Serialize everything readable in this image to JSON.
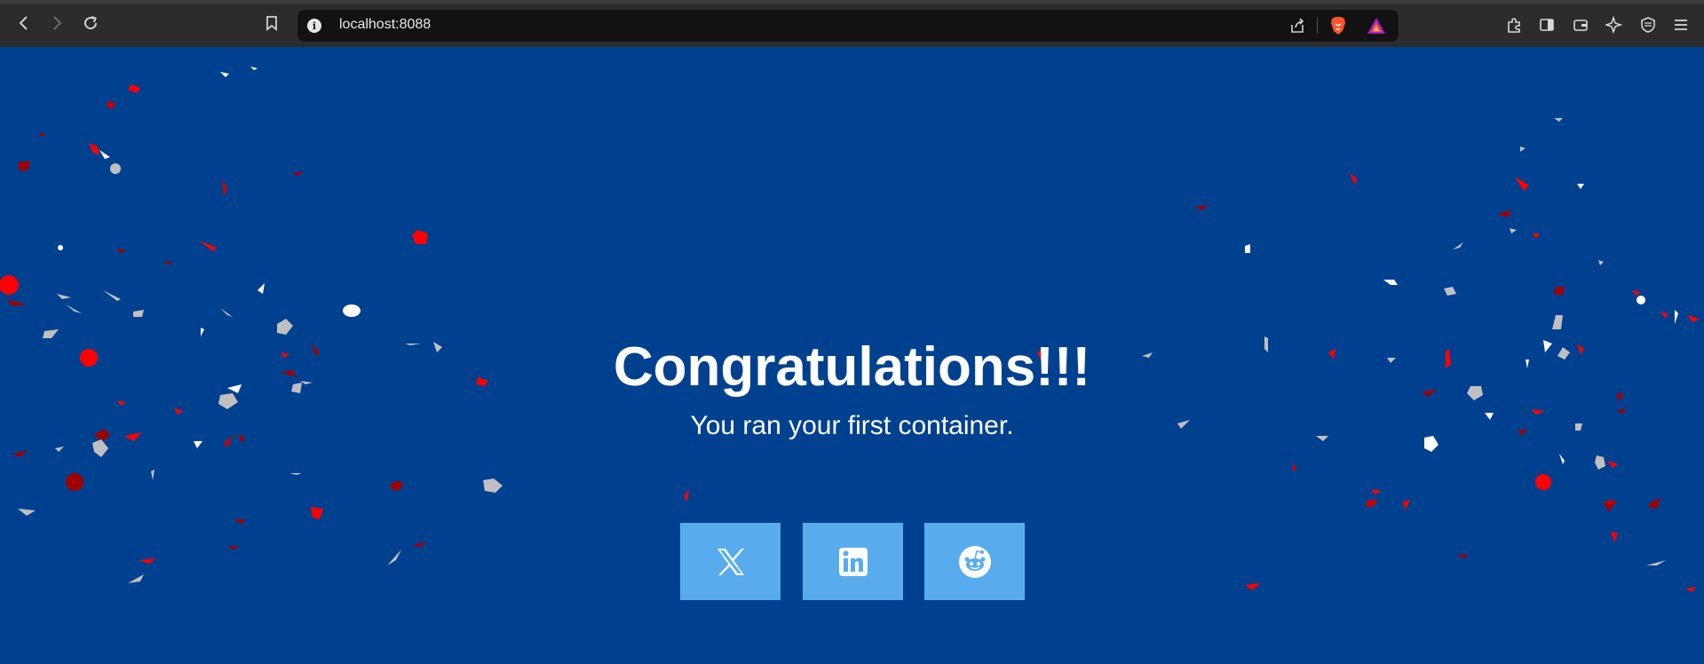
{
  "browser": {
    "url": "localhost:8088",
    "icons": {
      "back": "arrow-left-icon",
      "forward": "arrow-right-icon",
      "reload": "reload-icon",
      "bookmark": "bookmark-icon",
      "site_info": "info-icon",
      "share": "share-icon",
      "brave_shields": "brave-lion-icon",
      "brave_rewards": "brave-rewards-triangle-icon",
      "extensions": "puzzle-icon",
      "sidebar": "sidebar-icon",
      "wallet": "wallet-icon",
      "leo": "sparkle-icon",
      "vpn": "shield-icon",
      "menu": "hamburger-menu-icon"
    }
  },
  "page": {
    "title": "Congratulations!!!",
    "subtitle": "You ran your first container.",
    "share_buttons": [
      {
        "icon": "x-twitter-icon"
      },
      {
        "icon": "linkedin-icon"
      },
      {
        "icon": "reddit-icon"
      }
    ]
  },
  "colors": {
    "background": "#00418f",
    "button": "#58aced",
    "confetti": [
      "#ff0000",
      "#a00000",
      "#ffffff",
      "#c0c0c0"
    ]
  }
}
